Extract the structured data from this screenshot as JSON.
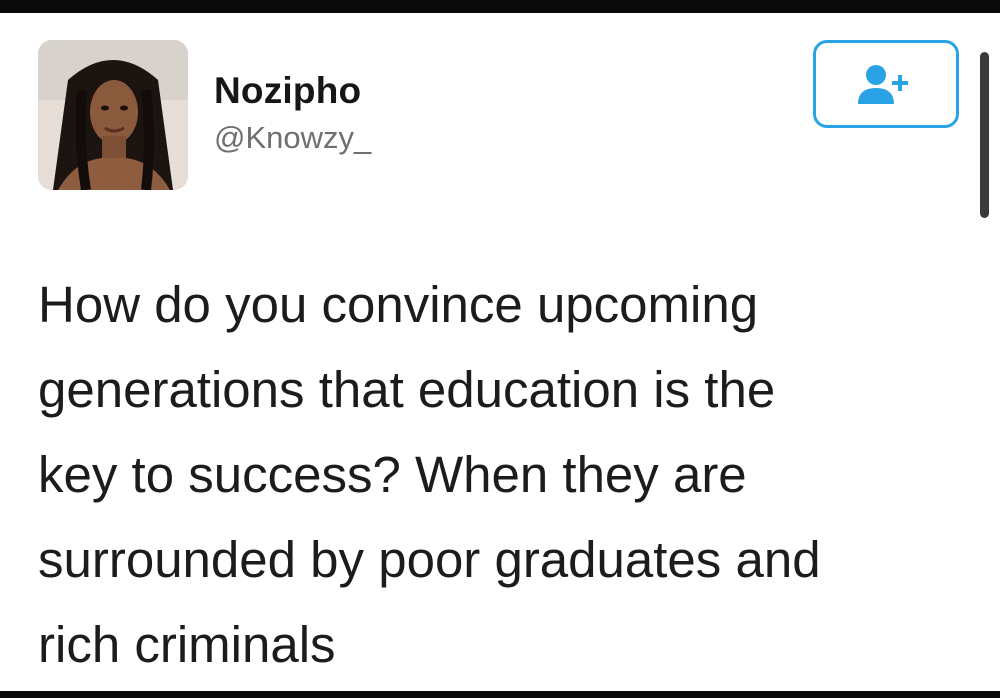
{
  "tweet": {
    "author": {
      "display_name": "Nozipho",
      "handle": "@Knowzy_"
    },
    "follow_button": {
      "icon": "add-user-icon",
      "color": "#2aa3e6"
    },
    "text_lines": [
      "How do you convince upcoming",
      "generations that education is the",
      "key to success? When they are",
      "surrounded by poor graduates and",
      "rich criminals"
    ]
  }
}
